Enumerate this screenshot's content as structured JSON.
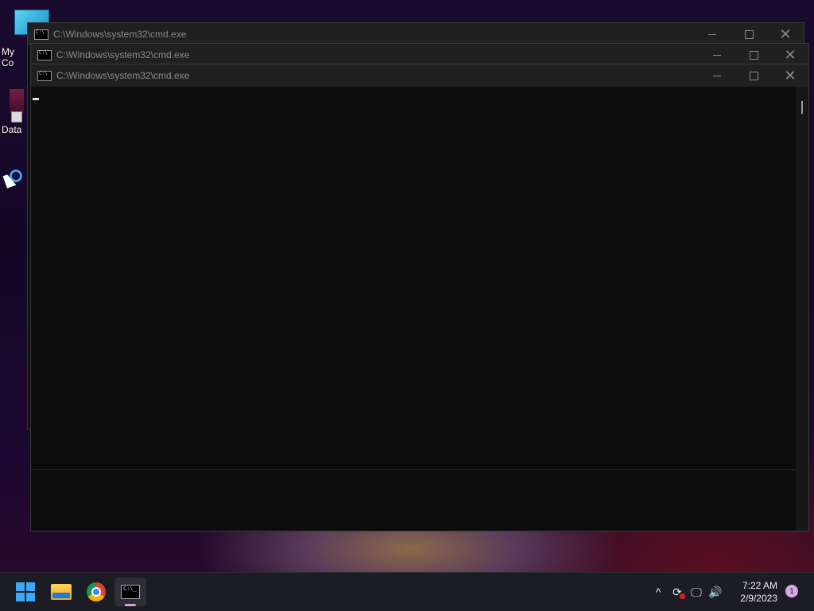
{
  "desktop": {
    "icons": [
      {
        "label": "My Co"
      },
      {
        "label": "Data"
      }
    ]
  },
  "windows": [
    {
      "title": "C:\\Windows\\system32\\cmd.exe",
      "state": "background"
    },
    {
      "title": "C:\\Windows\\system32\\cmd.exe",
      "state": "background"
    },
    {
      "title": "C:\\Windows\\system32\\cmd.exe",
      "state": "active"
    }
  ],
  "window_controls": {
    "minimize": "—",
    "maximize": "☐",
    "close": "✕"
  },
  "taskbar": {
    "apps": [
      {
        "icon": "windows-start-icon"
      },
      {
        "icon": "file-explorer-icon"
      },
      {
        "icon": "chrome-icon"
      },
      {
        "icon": "command-prompt-icon",
        "active": true
      }
    ],
    "tray": {
      "chevron": "^",
      "clock_time": "7:22 AM",
      "clock_date": "2/9/2023",
      "notification_count": "1"
    }
  },
  "colors": {
    "titlebar": "#202020",
    "console_bg": "#0c0c0c",
    "taskbar": "#1c1c24",
    "accent": "#3fa8f4"
  }
}
